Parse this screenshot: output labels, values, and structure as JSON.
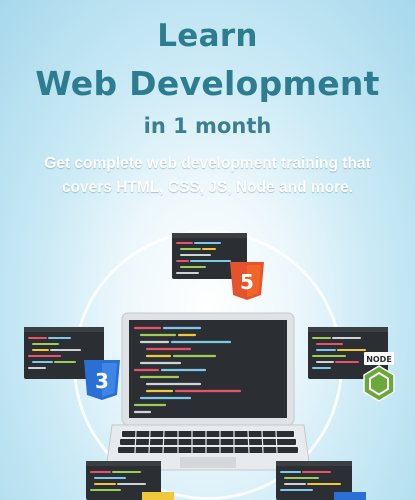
{
  "headline": {
    "line1": "Learn",
    "line2": "Web Development",
    "line3": "in 1 month"
  },
  "subtitle": {
    "line1": "Get complete web development training that",
    "line2": "covers HTML, CSS, JS, Node and more."
  },
  "badges": {
    "html5": "5",
    "css3": "3",
    "node": "NODE"
  },
  "colors": {
    "headline": "#2c7d8f",
    "subtitle": "#ffffff",
    "html5": "#e5532d",
    "css3": "#2a6fd4",
    "node": "#6aa83c",
    "js": "#f0c63a",
    "editor": "#2b2f33"
  },
  "icons": [
    "laptop-icon",
    "code-window-icon",
    "html5-icon",
    "css3-icon",
    "node-icon"
  ]
}
